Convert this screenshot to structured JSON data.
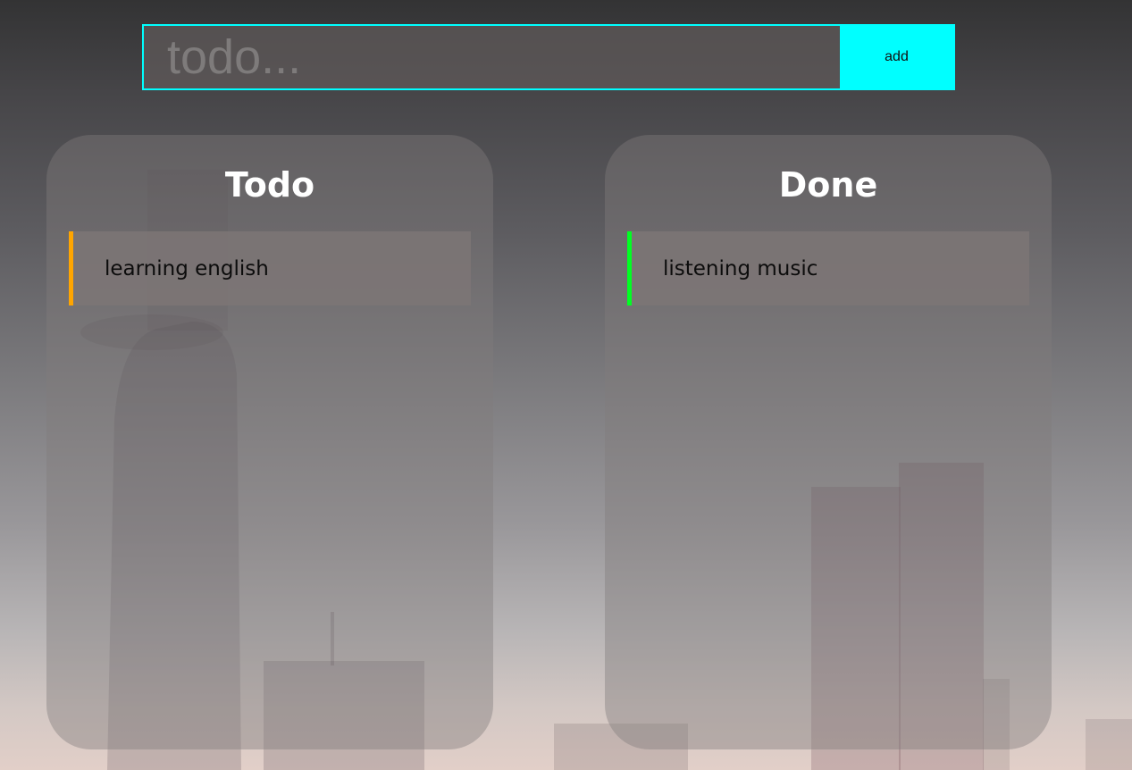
{
  "input": {
    "placeholder": "todo...",
    "value": "",
    "add_label": "add"
  },
  "columns": {
    "todo": {
      "title": "Todo",
      "items": [
        {
          "label": "learning english"
        }
      ]
    },
    "done": {
      "title": "Done",
      "items": [
        {
          "label": "listening music"
        }
      ]
    }
  },
  "colors": {
    "accent": "#00ffff",
    "todo_marker": "#ffa500",
    "done_marker": "#00ff22",
    "title_text": "#ffffff"
  }
}
